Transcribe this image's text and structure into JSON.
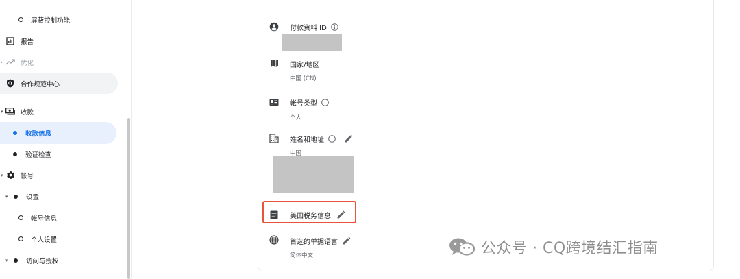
{
  "sidebar": {
    "items": [
      {
        "label": "屏蔽控制功能"
      },
      {
        "label": "报告"
      },
      {
        "label": "优化"
      },
      {
        "label": "合作规范中心"
      },
      {
        "label": "收款"
      },
      {
        "label": "收款信息"
      },
      {
        "label": "验证检查"
      },
      {
        "label": "帐号"
      },
      {
        "label": "设置"
      },
      {
        "label": "帐号信息"
      },
      {
        "label": "个人设置"
      },
      {
        "label": "访问与授权"
      }
    ]
  },
  "details": {
    "payment_profile_id": {
      "title": "付款资料 ID"
    },
    "country": {
      "title": "国家/地区",
      "value": "中国 (CN)"
    },
    "account_type": {
      "title": "帐号类型",
      "value": "个人"
    },
    "name_address": {
      "title": "姓名和地址",
      "value": "中国"
    },
    "us_tax": {
      "title": "美国税务信息"
    },
    "invoice_language": {
      "title": "首选的单据语言",
      "value": "简体中文"
    }
  },
  "watermark": {
    "text": "公众号 · CQ跨境结汇指南"
  },
  "colors": {
    "accent": "#1a73e8",
    "highlight": "#e8543a",
    "active_bg": "#e8f0fe"
  }
}
